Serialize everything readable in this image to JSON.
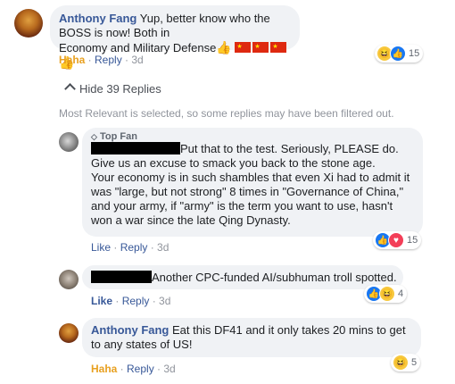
{
  "comment1": {
    "author": "Anthony Fang",
    "text_part1": "Yup, better know who the BOSS is now! Both in",
    "text_part2": "Economy and Military Defense",
    "emoji_thumb": "👍",
    "flags": [
      "china-flag",
      "china-flag",
      "china-flag"
    ],
    "reaction_type": "Haha",
    "reply_label": "Reply",
    "time": "3d",
    "reaction_count": "15",
    "reaction_icons": [
      "haha",
      "like"
    ]
  },
  "hide_replies": {
    "label": "Hide 39 Replies"
  },
  "filter_note": "Most Relevant is selected, so some replies may have been filtered out.",
  "reply1": {
    "badge": "Top Fan",
    "lines": [
      "Put that to the test. Seriously, PLEASE do.",
      "Give us an excuse to smack you back to the stone age.",
      "Your economy is in such shambles that even Xi had to admit it",
      "was \"large, but not strong\" 8 times in \"Governance of China,\"",
      "and your army, if \"army\" is the term you want to use, hasn't",
      "won a war since the late Qing Dynasty."
    ],
    "like_label": "Like",
    "reply_label": "Reply",
    "time": "3d",
    "reaction_count": "15",
    "reaction_icons": [
      "like",
      "love"
    ]
  },
  "reply2": {
    "text": "Another CPC-funded AI/subhuman troll spotted.",
    "like_label": "Like",
    "reply_label": "Reply",
    "time": "3d",
    "reaction_count": "4",
    "reaction_icons": [
      "like",
      "haha"
    ]
  },
  "reply3": {
    "author": "Anthony Fang",
    "text_line1": "Eat this DF41 and it only takes 20 mins to get",
    "text_line2": "to any states of US!",
    "reaction_type": "Haha",
    "reply_label": "Reply",
    "time": "3d",
    "reaction_count": "5",
    "reaction_icons": [
      "haha"
    ]
  },
  "colors": {
    "name": "#385898",
    "bubble": "#f0f2f5",
    "haha": "#e8a020",
    "like": "#1877f2"
  }
}
